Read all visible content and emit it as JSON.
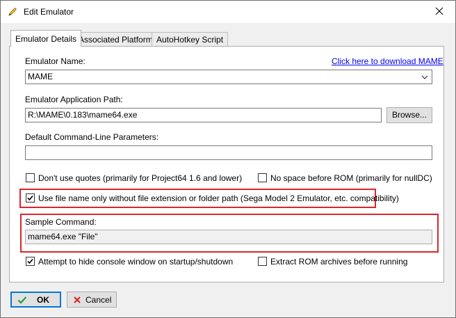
{
  "window": {
    "title": "Edit Emulator",
    "icon": "pencil-icon",
    "close_icon": "close-icon"
  },
  "tabs": [
    {
      "label": "Emulator Details",
      "active": true
    },
    {
      "label": "Associated Platforms",
      "active": false
    },
    {
      "label": "AutoHotkey Script",
      "active": false
    }
  ],
  "details": {
    "emulator_name_label": "Emulator Name:",
    "download_link": "Click here to download MAME",
    "emulator_name_value": "MAME",
    "app_path_label": "Emulator Application Path:",
    "app_path_value": "R:\\MAME\\0.183\\mame64.exe",
    "browse_label": "Browse...",
    "cmdline_label": "Default Command-Line Parameters:",
    "cmdline_value": "",
    "opt_no_quotes": {
      "label": "Don't use quotes (primarily for Project64 1.6 and lower)",
      "checked": false
    },
    "opt_no_space": {
      "label": "No space before ROM (primarily for nullDC)",
      "checked": false
    },
    "opt_filename_only": {
      "label": "Use file name only without file extension or folder path (Sega Model 2 Emulator, etc. compatibility)",
      "checked": true
    },
    "sample_label": "Sample Command:",
    "sample_value": "mame64.exe \"File\"",
    "opt_hide_console": {
      "label": "Attempt to hide console window on startup/shutdown",
      "checked": true
    },
    "opt_extract_rom": {
      "label": "Extract ROM archives before running",
      "checked": false
    }
  },
  "footer": {
    "ok_label": "OK",
    "cancel_label": "Cancel"
  },
  "colors": {
    "highlight": "#d9262c",
    "link": "#0000ee",
    "ok_check": "#1f9d3a",
    "cancel_x": "#d9262c",
    "focus_border": "#0078d7"
  }
}
